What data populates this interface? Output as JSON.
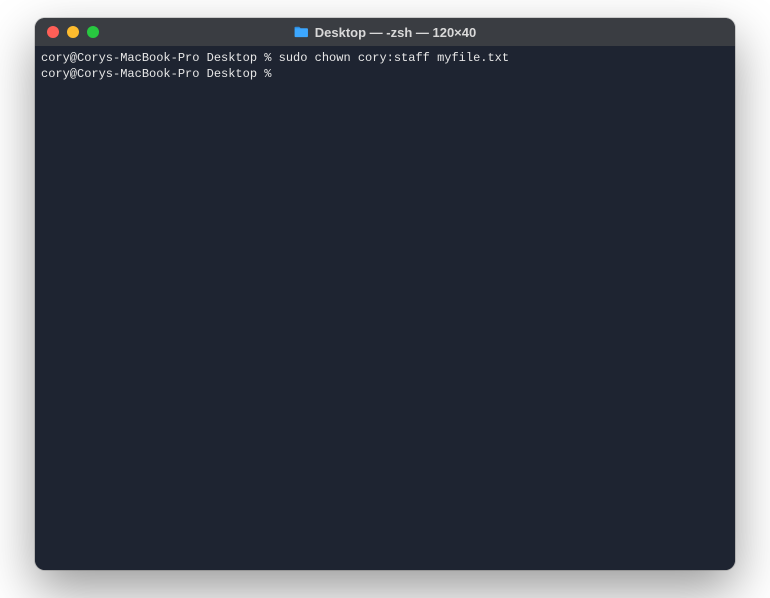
{
  "window": {
    "title": "Desktop — -zsh — 120×40"
  },
  "terminal": {
    "lines": [
      {
        "prompt": "cory@Corys-MacBook-Pro Desktop % ",
        "command": "sudo chown cory:staff myfile.txt"
      },
      {
        "prompt": "cory@Corys-MacBook-Pro Desktop % ",
        "command": ""
      }
    ]
  }
}
